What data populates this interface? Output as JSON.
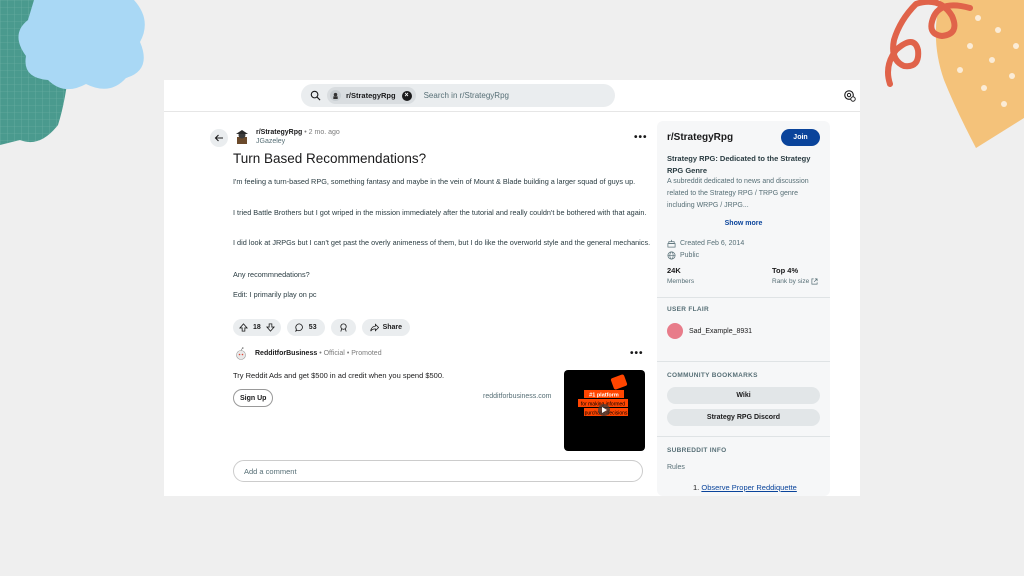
{
  "search": {
    "community_chip": "r/StrategyRpg",
    "placeholder": "Search in r/StrategyRpg"
  },
  "post": {
    "subreddit": "r/StrategyRpg",
    "separator": "•",
    "age": "2 mo. ago",
    "author": "JGazeley",
    "title": "Turn Based Recommendations?",
    "paragraphs": [
      "I'm feeling a turn-based RPG, something fantasy and maybe in the vein of Mount & Blade building a larger squad of guys up.",
      "I tried Battle Brothers but I got wriped in the mission immediately after the tutorial and really couldn't be bothered with that again.",
      "I did look at JRPGs but I can't get past the overly animeness of them, but I do like the overworld style and the general mechanics.",
      "Any recommnedations?",
      "Edit: I primarily play on pc"
    ],
    "votes": "18",
    "comments": "53",
    "share_label": "Share",
    "more": "•••"
  },
  "ad": {
    "name": "RedditforBusiness",
    "official": "Official",
    "promoted": "Promoted",
    "separator": "•",
    "text": "Try Reddit Ads and get $500 in ad credit when you spend $500.",
    "button": "Sign Up",
    "domain": "redditforbusiness.com",
    "thumb_line1": "#1 platform",
    "thumb_line2": "for making informed",
    "thumb_line3": "purchase decisions"
  },
  "comment_box": {
    "placeholder": "Add a comment"
  },
  "sidebar": {
    "name": "r/StrategyRpg",
    "join": "Join",
    "title": "Strategy RPG: Dedicated to the Strategy RPG Genre",
    "description": "A subreddit dedicated to news and discussion related to the Strategy RPG / TRPG genre including WRPG / JRPG...",
    "show_more": "Show more",
    "created": "Created Feb 6, 2014",
    "visibility": "Public",
    "members_count": "24K",
    "members_label": "Members",
    "rank": "Top 4%",
    "rank_label": "Rank by size",
    "user_flair_heading": "USER FLAIR",
    "flair_user": "Sad_Example_8931",
    "bookmarks_heading": "COMMUNITY BOOKMARKS",
    "bookmarks": [
      "Wiki",
      "Strategy RPG Discord"
    ],
    "info_heading": "SUBREDDIT INFO",
    "rules_label": "Rules",
    "rule_1_num": "1.",
    "rule_1": "Observe Proper Reddiquette"
  },
  "colors": {
    "join_bg": "#0a449b",
    "deco_teal": "#4a9a8e",
    "deco_blue": "#a9d8f5",
    "deco_orange": "#f4c27a",
    "deco_red": "#e0634a"
  }
}
